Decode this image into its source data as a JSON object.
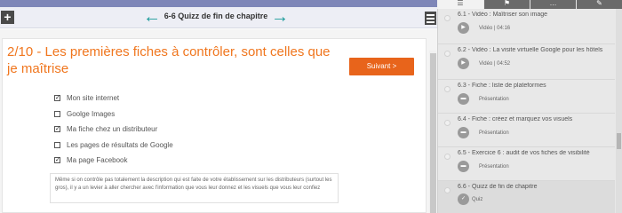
{
  "header": {
    "add_glyph": "+",
    "prev_glyph": "←",
    "next_glyph": "→",
    "chapter_title": "6-6 Quizz de fin de chapitre"
  },
  "quiz": {
    "question": "2/10 - Les premières fiches à contrôler, sont celles que je maîtrise",
    "next_button": "Suivant >",
    "options": [
      {
        "label": "Mon site internet",
        "checked": true
      },
      {
        "label": "Goolge Images",
        "checked": false
      },
      {
        "label": "Ma fiche chez un distributeur",
        "checked": true
      },
      {
        "label": "Les pages de résultats de Google",
        "checked": false
      },
      {
        "label": "Ma page Facebook",
        "checked": true
      }
    ],
    "explanation": "Même si on contrôle pas totalement la description qui est faite de votre établissement sur les distributeurs (surtout les gros), il y a un levier à aller chercher avec l'information que vous leur donnez et les visuels que vous leur confiez"
  },
  "sidebar": {
    "tabs": [
      {
        "icon": "list-icon",
        "glyph": "☰",
        "active": true
      },
      {
        "icon": "flag-icon",
        "glyph": "⚑",
        "active": false
      },
      {
        "icon": "chat-icon",
        "glyph": "…",
        "active": false
      },
      {
        "icon": "pencil-icon",
        "glyph": "✎",
        "active": false
      }
    ],
    "items": [
      {
        "title": "6.1 - Vidéo : Maîtriser son image",
        "meta": "Vidéo | 04:16",
        "icon": "video-icon",
        "active": false
      },
      {
        "title": "6.2 - Vidéo : La visite virtuelle Google pour les hôtels",
        "meta": "Vidéo | 04:52",
        "icon": "video-icon",
        "active": false
      },
      {
        "title": "6.3 - Fiche : liste de plateformes",
        "meta": "Présentation",
        "icon": "presentation-icon",
        "active": false
      },
      {
        "title": "6.4 - Fiche : créez et marquez vos visuels",
        "meta": "Présentation",
        "icon": "presentation-icon",
        "active": false
      },
      {
        "title": "6.5 - Exercice 6 : audit de vos fiches de visibilité",
        "meta": "Présentation",
        "icon": "presentation-icon",
        "active": false
      },
      {
        "title": "6.6 - Quizz de fin de chapitre",
        "meta": "Quiz",
        "icon": "quiz-icon",
        "active": true
      }
    ]
  },
  "colors": {
    "accent_orange": "#e8641b",
    "question_orange": "#f0761e",
    "nav_teal": "#1a9a9a",
    "top_strip": "#7e86b8"
  }
}
